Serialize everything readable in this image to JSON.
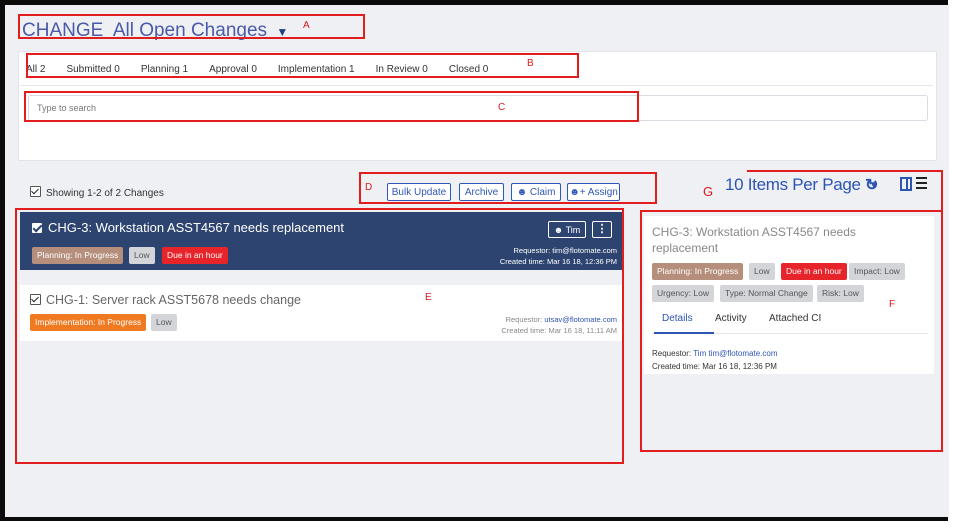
{
  "header": {
    "module": "CHANGE",
    "view": "All Open Changes"
  },
  "status_tabs": [
    "All 2",
    "Submitted 0",
    "Planning 1",
    "Approval 0",
    "Implementation 1",
    "In Review 0",
    "Closed 0"
  ],
  "search": {
    "placeholder": "Type to search"
  },
  "toolbar": {
    "showing": "Showing 1-2 of 2 Changes",
    "bulk_update": "Bulk Update",
    "archive": "Archive",
    "claim": "Claim",
    "assign": "Assign",
    "items_per_page": "10 Items Per Page"
  },
  "changes": [
    {
      "id": "CHG-3",
      "title": "CHG-3: Workstation ASST4567 needs replacement",
      "tags": [
        "Planning: In Progress",
        "Low",
        "Due in an hour"
      ],
      "assignee": "Tim",
      "requestor_label": "Requestor:",
      "requestor": "tim@flotomate.com",
      "created_label": "Created time:",
      "created": "Mar 16 18, 12:36 PM"
    },
    {
      "id": "CHG-1",
      "title": "CHG-1: Server rack ASST5678 needs change",
      "tags": [
        "Implementation: In Progress",
        "Low"
      ],
      "requestor_label": "Requestor:",
      "requestor": "utsav@flotomate.com",
      "created_label": "Created time:",
      "created": "Mar 16 18, 11:11 AM"
    }
  ],
  "detail": {
    "title": "CHG-3: Workstation ASST4567 needs replacement",
    "tags": [
      "Planning: In Progress",
      "Low",
      "Due in an hour",
      "Impact: Low",
      "Urgency: Low",
      "Type: Normal Change",
      "Risk: Low"
    ],
    "tabs": [
      "Details",
      "Activity",
      "Attached CI"
    ],
    "requestor_label": "Requestor:",
    "requestor": "Tim tim@flotomate.com",
    "created_label": "Created time:",
    "created": "Mar 16 18, 12:36 PM"
  },
  "annotations": {
    "a": "A",
    "b": "B",
    "c": "C",
    "d": "D",
    "e": "E",
    "f": "F",
    "g": "G"
  },
  "colors": {
    "accent": "#2c54b5",
    "selected_row": "#2d4470",
    "annotation": "#e11d1d",
    "due": "#e8242b",
    "planning": "#b58f7b",
    "implementation": "#ef7a22"
  }
}
